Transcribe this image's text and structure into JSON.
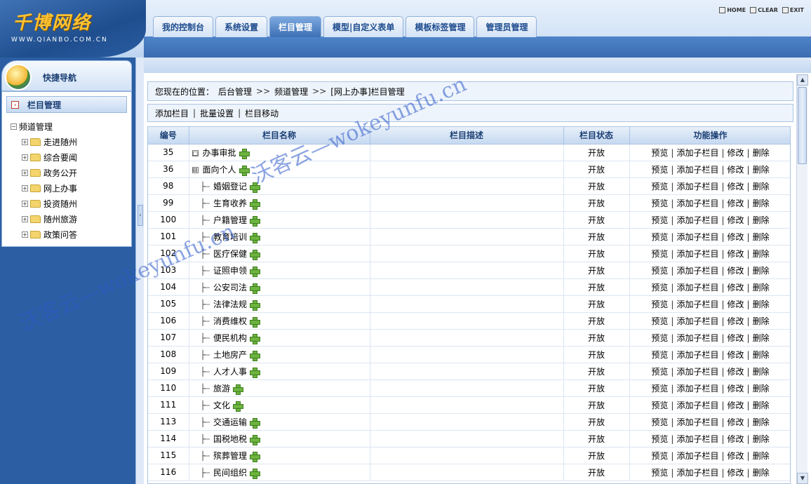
{
  "logo": {
    "title": "千博网络",
    "subtitle": "WWW.QIANBO.COM.CN"
  },
  "tabs": [
    {
      "label": "我的控制台",
      "active": false
    },
    {
      "label": "系统设置",
      "active": false
    },
    {
      "label": "栏目管理",
      "active": true
    },
    {
      "label": "模型|自定义表单",
      "active": false
    },
    {
      "label": "模板标签管理",
      "active": false
    },
    {
      "label": "管理员管理",
      "active": false
    }
  ],
  "tool_links": {
    "home": "HOME",
    "clear": "CLEAR",
    "exit": "EXIT"
  },
  "sidebar": {
    "quick_nav": "快捷导航",
    "section_title": "栏目管理",
    "tree_root": "频道管理",
    "tree_items": [
      "走进随州",
      "综合要闻",
      "政务公开",
      "网上办事",
      "投资随州",
      "随州旅游",
      "政策问答"
    ]
  },
  "breadcrumb": {
    "prefix": "您现在的位置：",
    "parts": [
      "后台管理",
      "频道管理",
      "[网上办事]栏目管理"
    ],
    "separator": ">>"
  },
  "actions": [
    "添加栏目",
    "批量设置",
    "栏目移动"
  ],
  "table": {
    "headers": [
      "编号",
      "栏目名称",
      "栏目描述",
      "栏目状态",
      "功能操作"
    ],
    "ops": [
      "预览",
      "添加子栏目",
      "修改",
      "删除"
    ],
    "rows": [
      {
        "id": "35",
        "name": "办事审批",
        "level": 0,
        "toggle": "□",
        "status": "开放"
      },
      {
        "id": "36",
        "name": "面向个人",
        "level": 0,
        "toggle": "⊟",
        "status": "开放"
      },
      {
        "id": "98",
        "name": "婚姻登记",
        "level": 1,
        "status": "开放"
      },
      {
        "id": "99",
        "name": "生育收养",
        "level": 1,
        "status": "开放"
      },
      {
        "id": "100",
        "name": "户籍管理",
        "level": 1,
        "status": "开放"
      },
      {
        "id": "101",
        "name": "教育培训",
        "level": 1,
        "status": "开放"
      },
      {
        "id": "102",
        "name": "医疗保健",
        "level": 1,
        "status": "开放"
      },
      {
        "id": "103",
        "name": "证照申领",
        "level": 1,
        "status": "开放"
      },
      {
        "id": "104",
        "name": "公安司法",
        "level": 1,
        "status": "开放"
      },
      {
        "id": "105",
        "name": "法律法规",
        "level": 1,
        "status": "开放"
      },
      {
        "id": "106",
        "name": "消费维权",
        "level": 1,
        "status": "开放"
      },
      {
        "id": "107",
        "name": "便民机构",
        "level": 1,
        "status": "开放"
      },
      {
        "id": "108",
        "name": "土地房产",
        "level": 1,
        "status": "开放"
      },
      {
        "id": "109",
        "name": "人才人事",
        "level": 1,
        "status": "开放"
      },
      {
        "id": "110",
        "name": "旅游",
        "level": 1,
        "status": "开放"
      },
      {
        "id": "111",
        "name": "文化",
        "level": 1,
        "status": "开放"
      },
      {
        "id": "113",
        "name": "交通运输",
        "level": 1,
        "status": "开放"
      },
      {
        "id": "114",
        "name": "国税地税",
        "level": 1,
        "status": "开放"
      },
      {
        "id": "115",
        "name": "殡葬管理",
        "level": 1,
        "status": "开放"
      },
      {
        "id": "116",
        "name": "民间组织",
        "level": 1,
        "status": "开放"
      }
    ]
  },
  "watermark": {
    "text1": "沃客云—wokeyunfu.cn",
    "text2": "沃客云—wokeyunfu.cn"
  },
  "colors": {
    "header_blue": "#2b5ea3",
    "accent_green": "#6db33f",
    "tab_text": "#1c4a8c"
  }
}
